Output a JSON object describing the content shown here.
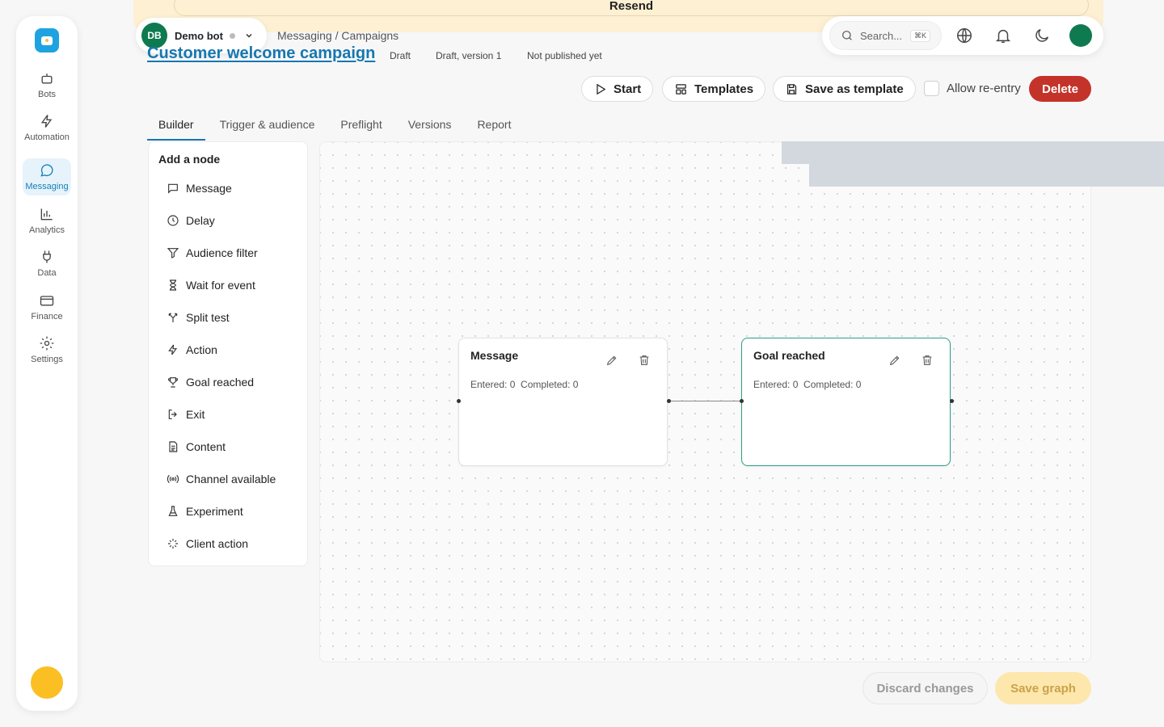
{
  "banner": {
    "resend_label": "Resend"
  },
  "sidebar": {
    "items": [
      {
        "label": "Bots",
        "icon": "bot-icon"
      },
      {
        "label": "Automation",
        "icon": "lightning-icon"
      },
      {
        "label": "Messaging",
        "icon": "chat-bubble-icon"
      },
      {
        "label": "Analytics",
        "icon": "bar-chart-icon"
      },
      {
        "label": "Data",
        "icon": "plug-icon"
      },
      {
        "label": "Finance",
        "icon": "credit-card-icon"
      },
      {
        "label": "Settings",
        "icon": "gear-icon"
      }
    ],
    "active": "Messaging"
  },
  "bot": {
    "initials": "DB",
    "name": "Demo bot"
  },
  "breadcrumb": "Messaging / Campaigns",
  "campaign": {
    "title": "Customer welcome campaign",
    "status": "Draft",
    "version": "Draft, version 1",
    "published": "Not published yet"
  },
  "search": {
    "placeholder": "Search...",
    "shortcut": "⌘K"
  },
  "actions": {
    "start": "Start",
    "templates": "Templates",
    "save_template": "Save as template",
    "allow_reentry": "Allow re-entry",
    "delete": "Delete"
  },
  "tabs": [
    "Builder",
    "Trigger & audience",
    "Preflight",
    "Versions",
    "Report"
  ],
  "palette": {
    "title": "Add a node",
    "items": [
      {
        "label": "Message",
        "icon": "message-icon"
      },
      {
        "label": "Delay",
        "icon": "clock-icon"
      },
      {
        "label": "Audience filter",
        "icon": "filter-icon"
      },
      {
        "label": "Wait for event",
        "icon": "hourglass-icon"
      },
      {
        "label": "Split test",
        "icon": "split-icon"
      },
      {
        "label": "Action",
        "icon": "lightning-icon"
      },
      {
        "label": "Goal reached",
        "icon": "trophy-icon"
      },
      {
        "label": "Exit",
        "icon": "exit-icon"
      },
      {
        "label": "Content",
        "icon": "document-icon"
      },
      {
        "label": "Channel available",
        "icon": "broadcast-icon"
      },
      {
        "label": "Experiment",
        "icon": "flask-icon"
      },
      {
        "label": "Client action",
        "icon": "sparkle-icon"
      }
    ]
  },
  "nodes": [
    {
      "title": "Message",
      "stats": "Entered: 0  Completed: 0"
    },
    {
      "title": "Goal reached",
      "stats": "Entered: 0  Completed: 0"
    }
  ],
  "footer": {
    "discard": "Discard changes",
    "save": "Save graph"
  },
  "colors": {
    "brand": "#1677b0",
    "danger": "#c4332a",
    "success": "#0f7a4f",
    "warning": "#fbbf24"
  }
}
